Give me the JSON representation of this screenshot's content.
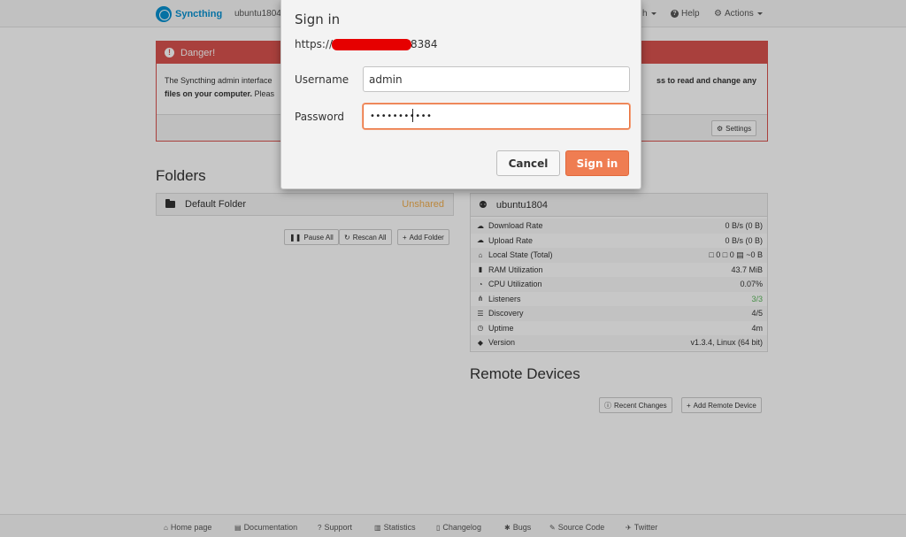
{
  "navbar": {
    "brand": "Syncthing",
    "device": "ubuntu1804",
    "language_fragment": "h",
    "help": "Help",
    "actions": "Actions"
  },
  "danger": {
    "title": "Danger!",
    "line1": "The Syncthing admin interface",
    "line1_right": "ss to read and change any",
    "line2_bold": "files on your computer.",
    "line2": " Pleas",
    "settings_button": "Settings"
  },
  "folders": {
    "heading": "Folders",
    "items": [
      {
        "name": "Default Folder",
        "status": "Unshared"
      }
    ],
    "buttons": {
      "pause": "Pause All",
      "rescan": "Rescan All",
      "add": "Add Folder"
    }
  },
  "this_device": {
    "name": "ubuntu1804",
    "stats": [
      {
        "icon": "cloud-download-icon",
        "label": "Download Rate",
        "value": "0 B/s (0 B)"
      },
      {
        "icon": "cloud-upload-icon",
        "label": "Upload Rate",
        "value": "0 B/s (0 B)"
      },
      {
        "icon": "home-icon",
        "label": "Local State (Total)",
        "value": "□ 0  □ 0  ▤ ~0 B"
      },
      {
        "icon": "memory-icon",
        "label": "RAM Utilization",
        "value": "43.7 MiB"
      },
      {
        "icon": "dashboard-icon",
        "label": "CPU Utilization",
        "value": "0.07%"
      },
      {
        "icon": "sitemap-icon",
        "label": "Listeners",
        "value": "3/3"
      },
      {
        "icon": "signpost-icon",
        "label": "Discovery",
        "value": "4/5"
      },
      {
        "icon": "clock-icon",
        "label": "Uptime",
        "value": "4m"
      },
      {
        "icon": "tag-icon",
        "label": "Version",
        "value": "v1.3.4, Linux (64 bit)"
      }
    ]
  },
  "remote": {
    "heading": "Remote Devices",
    "buttons": {
      "recent": "Recent Changes",
      "add": "Add Remote Device"
    }
  },
  "footer": {
    "links": [
      "Home page",
      "Documentation",
      "Support",
      "Statistics",
      "Changelog",
      "Bugs",
      "Source Code",
      "Twitter"
    ]
  },
  "dialog": {
    "title": "Sign in",
    "url_prefix": "https://",
    "url_suffix": "8384",
    "username_label": "Username",
    "username_value": "admin",
    "password_label": "Password",
    "password_mask": "•••••••••••",
    "cancel": "Cancel",
    "signin": "Sign in"
  },
  "colors": {
    "brand": "#0891d1",
    "danger": "#d9534f",
    "warning": "#f0ad4e",
    "accent": "#ef7d52",
    "success": "#5cb85c"
  }
}
